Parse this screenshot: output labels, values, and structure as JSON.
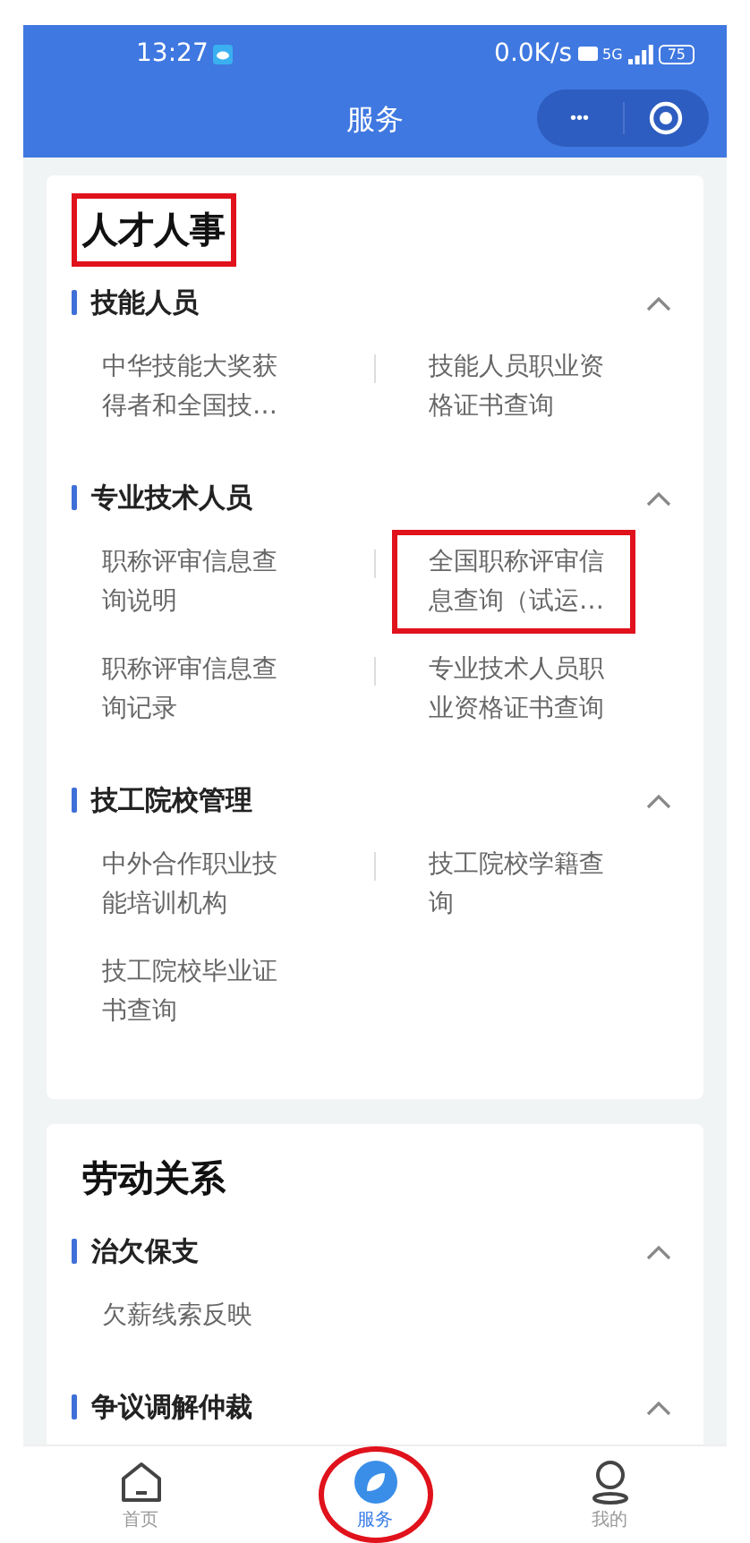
{
  "status_bar": {
    "time": "13:27",
    "speed": "0.0K/s",
    "network": "5G",
    "battery": "75"
  },
  "nav": {
    "title": "服务",
    "more": "•••"
  },
  "sections": [
    {
      "title": "人才人事",
      "highlighted": true,
      "groups": [
        {
          "title": "技能人员",
          "expanded": true,
          "items": [
            {
              "label": "中华技能大奖获得者和全国技…",
              "highlighted": false
            },
            {
              "label": "技能人员职业资格证书查询",
              "highlighted": false
            }
          ]
        },
        {
          "title": "专业技术人员",
          "expanded": true,
          "items": [
            {
              "label": "职称评审信息查询说明",
              "highlighted": false
            },
            {
              "label": "全国职称评审信息查询（试运…",
              "highlighted": true
            },
            {
              "label": "职称评审信息查询记录",
              "highlighted": false
            },
            {
              "label": "专业技术人员职业资格证书查询",
              "highlighted": false
            }
          ]
        },
        {
          "title": "技工院校管理",
          "expanded": true,
          "items": [
            {
              "label": "中外合作职业技能培训机构",
              "highlighted": false
            },
            {
              "label": "技工院校学籍查询",
              "highlighted": false
            },
            {
              "label": "技工院校毕业证书查询",
              "highlighted": false
            }
          ]
        }
      ]
    },
    {
      "title": "劳动关系",
      "highlighted": false,
      "groups": [
        {
          "title": "治欠保支",
          "expanded": true,
          "items": [
            {
              "label": "欠薪线索反映",
              "highlighted": false
            }
          ]
        },
        {
          "title": "争议调解仲裁",
          "expanded": true
        }
      ]
    }
  ],
  "tabs": [
    {
      "label": "首页",
      "kind": "home",
      "selected": false,
      "circled": false
    },
    {
      "label": "服务",
      "kind": "service",
      "selected": true,
      "circled": true
    },
    {
      "label": "我的",
      "kind": "profile",
      "selected": false,
      "circled": false
    }
  ]
}
